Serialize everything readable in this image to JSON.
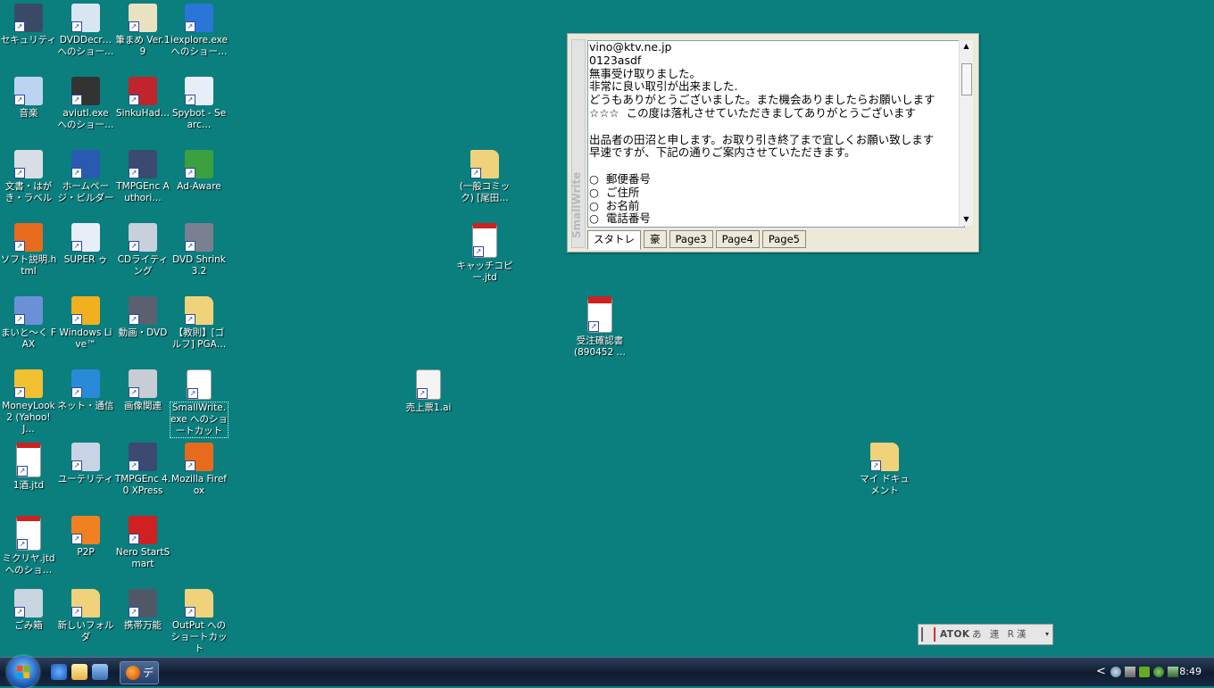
{
  "desktop_icons": [
    {
      "label": "セキュリティ",
      "icon": "lock-icon",
      "color": "#3a4a66"
    },
    {
      "label": "DVDDecr…へのショー…",
      "icon": "dvd-icon",
      "color": "#d8e6f2"
    },
    {
      "label": "筆まめ Ver.19",
      "icon": "card-icon",
      "color": "#e9e2c0"
    },
    {
      "label": "iexplore.exe へのショー…",
      "icon": "ie-icon",
      "color": "#2a76d6"
    },
    {
      "label": "音楽",
      "icon": "music-icon",
      "color": "#bcd4f0"
    },
    {
      "label": "aviutl.exe へのショー…",
      "icon": "film-icon",
      "color": "#333333"
    },
    {
      "label": "SinkuHad…",
      "icon": "sinku-icon",
      "color": "#c0242c"
    },
    {
      "label": "Spybot - Searc…",
      "icon": "spybot-icon",
      "color": "#e8eef8"
    },
    {
      "label": "文書・はがき・ラベル",
      "icon": "printer-icon",
      "color": "#d8dde6"
    },
    {
      "label": "ホームページ・ビルダー",
      "icon": "globe-icon",
      "color": "#2a5ab0"
    },
    {
      "label": "TMPGEnc Authori…",
      "icon": "tmpgenc-icon",
      "color": "#3a4a70"
    },
    {
      "label": "Ad-Aware",
      "icon": "adaware-icon",
      "color": "#3aa040"
    },
    {
      "label": "ソフト説明.html",
      "icon": "firefox-icon",
      "color": "#e86a1c"
    },
    {
      "label": "SUPER ゥ",
      "icon": "super-icon",
      "color": "#e8eef8"
    },
    {
      "label": "CDライティング",
      "icon": "cd-icon",
      "color": "#c8d0dc"
    },
    {
      "label": "DVD Shrink 3.2",
      "icon": "shrink-icon",
      "color": "#7a8090"
    },
    {
      "label": "まいと〜く FAX",
      "icon": "fax-icon",
      "color": "#6a90d8"
    },
    {
      "label": "Windows Live™",
      "icon": "live-icon",
      "color": "#f0b020"
    },
    {
      "label": "動画・DVD",
      "icon": "camera-icon",
      "color": "#5a6070"
    },
    {
      "label": "【教則】[ゴルフ] PGA…",
      "icon": "folder-icon",
      "color": "#f0d27a"
    },
    {
      "label": "MoneyLook2 (Yahoo! J…",
      "icon": "yen-icon",
      "color": "#f0c030"
    },
    {
      "label": "ネット・通信",
      "icon": "net-icon",
      "color": "#2a8ad8"
    },
    {
      "label": "画像関連",
      "icon": "photo-icon",
      "color": "#c8ccd4"
    },
    {
      "label": "SmallWrite.exe へのショートカット",
      "icon": "smallwrite-icon",
      "color": "#ffffff"
    },
    {
      "label": "1酒.jtd",
      "icon": "jtd-icon",
      "color": "#ffffff"
    },
    {
      "label": "ユーテリティ",
      "icon": "utility-icon",
      "color": "#c8d4e4"
    },
    {
      "label": "TMPGEnc 4.0 XPress",
      "icon": "tmpgenc-icon",
      "color": "#3a4a70"
    },
    {
      "label": "Mozilla Firefox",
      "icon": "firefox-icon",
      "color": "#e86a1c"
    },
    {
      "label": "ミクリヤ.jtd へのショ…",
      "icon": "jtd-icon",
      "color": "#ffffff"
    },
    {
      "label": "P2P",
      "icon": "p2p-icon",
      "color": "#f08020"
    },
    {
      "label": "Nero StartSmart",
      "icon": "nero-icon",
      "color": "#d02020"
    },
    {
      "label": "ごみ箱",
      "icon": "trash-icon",
      "color": "#c8d4e0"
    },
    {
      "label": "新しいフォルダ",
      "icon": "folder-icon",
      "color": "#f0d27a"
    },
    {
      "label": "携帯万能",
      "icon": "phone-icon",
      "color": "#505868"
    },
    {
      "label": "OutPut へのショートカット",
      "icon": "folder-icon",
      "color": "#f0d27a"
    },
    {
      "label": "(一般コミック) [尾田…",
      "icon": "folder-icon",
      "color": "#f0d27a"
    },
    {
      "label": "キャッチコピー.jtd",
      "icon": "jtd-icon",
      "color": "#ffffff"
    },
    {
      "label": "受注確認書 (890452 …",
      "icon": "pdf-icon",
      "color": "#ffffff"
    },
    {
      "label": "売上票1.ai",
      "icon": "ai-icon",
      "color": "#f4f4f4"
    },
    {
      "label": "マイ ドキュメント",
      "icon": "mydocs-icon",
      "color": "#f0d27a"
    }
  ],
  "smallwrite": {
    "side_title": "SmallWrite",
    "text_lines": [
      "vino@ktv.ne.jp",
      "0123asdf",
      "無事受け取りました。",
      "非常に良い取引が出来ました.",
      "どうもありがとうございました。また機会ありましたらお願いします",
      "☆☆☆  この度は落札させていただきましてありがとうございます  ",
      "",
      "出品者の田沼と申します。お取り引き終了まで宜しくお願い致します",
      "早速ですが、下記の通りご案内させていただきます。",
      "",
      "○  郵便番号",
      "○  ご住所",
      "○  お名前",
      "○  電話番号"
    ],
    "tabs": [
      "スタトレ",
      "豪",
      "Page3",
      "Page4",
      "Page5"
    ]
  },
  "atok": {
    "logo": "ATOK",
    "modes": "あ 連 R漢"
  },
  "taskbar": {
    "task_label": "デ",
    "clock": "8:49",
    "tray_chevron": "<"
  }
}
